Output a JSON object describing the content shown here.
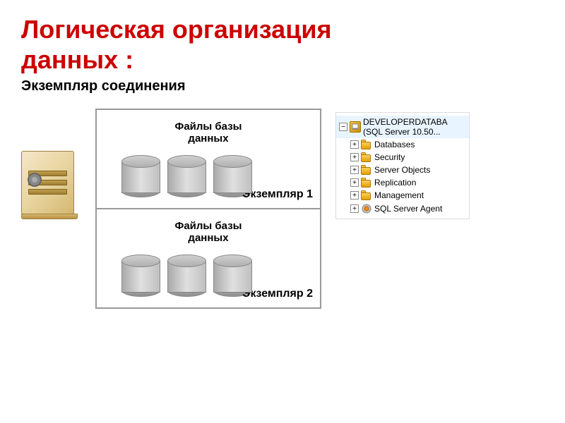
{
  "title": {
    "line1": "Логическая организация",
    "line2": "данных :"
  },
  "subtitle": "Экземпляр соединения",
  "instance1": {
    "files_label_line1": "Файлы базы",
    "files_label_line2": "данных",
    "label": "Экземпляр 1"
  },
  "instance2": {
    "files_label_line1": "Файлы базы",
    "files_label_line2": "данных",
    "label": "Экземпляр 2"
  },
  "tree": {
    "root": "DEVELOPERDATABA (SQL Server 10.50...",
    "items": [
      {
        "label": "Databases",
        "indent": 1
      },
      {
        "label": "Security",
        "indent": 1
      },
      {
        "label": "Server Objects",
        "indent": 1
      },
      {
        "label": "Replication",
        "indent": 1
      },
      {
        "label": "Management",
        "indent": 1
      },
      {
        "label": "SQL Server Agent",
        "indent": 1
      }
    ]
  }
}
